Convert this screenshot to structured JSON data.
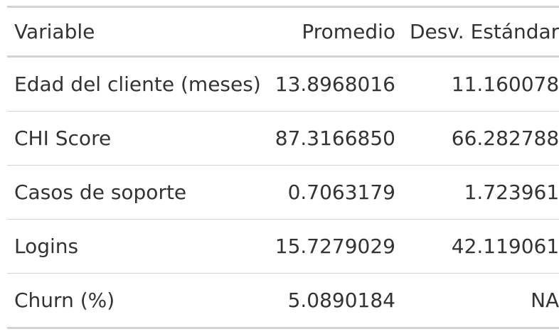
{
  "table": {
    "headers": [
      "Variable",
      "Promedio",
      "Desv. Estándar"
    ],
    "rows": [
      [
        "Edad del cliente (meses)",
        "13.8968016",
        "11.160078"
      ],
      [
        "CHI Score",
        "87.3166850",
        "66.282788"
      ],
      [
        "Casos de soporte",
        "0.7063179",
        "1.723961"
      ],
      [
        "Logins",
        "15.7279029",
        "42.119061"
      ],
      [
        "Churn (%)",
        "5.0890184",
        "NA"
      ]
    ]
  }
}
